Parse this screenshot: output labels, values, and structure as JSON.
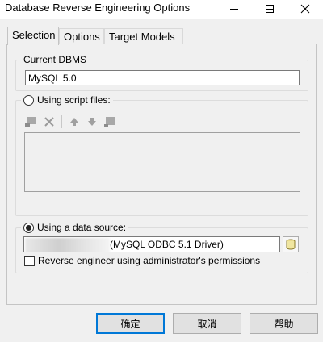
{
  "window": {
    "title": "Database Reverse Engineering Options"
  },
  "tabs": [
    {
      "label": "Selection",
      "active": true
    },
    {
      "label": "Options",
      "active": false
    },
    {
      "label": "Target Models",
      "active": false
    }
  ],
  "current_dbms": {
    "legend": "Current DBMS",
    "value": "MySQL 5.0"
  },
  "script_files": {
    "legend": "Using script files:",
    "selected": false,
    "toolbar_icons": [
      "add-file-icon",
      "delete-icon",
      "move-up-icon",
      "move-down-icon",
      "add-folder-icon"
    ]
  },
  "data_source": {
    "legend": "Using a data source:",
    "selected": true,
    "value": "(MySQL ODBC 5.1 Driver)",
    "admin_checkbox_label": "Reverse engineer using administrator's permissions",
    "admin_checked": false
  },
  "buttons": {
    "ok": "确定",
    "cancel": "取消",
    "help": "帮助"
  },
  "colors": {
    "accent": "#0078d7",
    "background": "#f0f0f0"
  }
}
